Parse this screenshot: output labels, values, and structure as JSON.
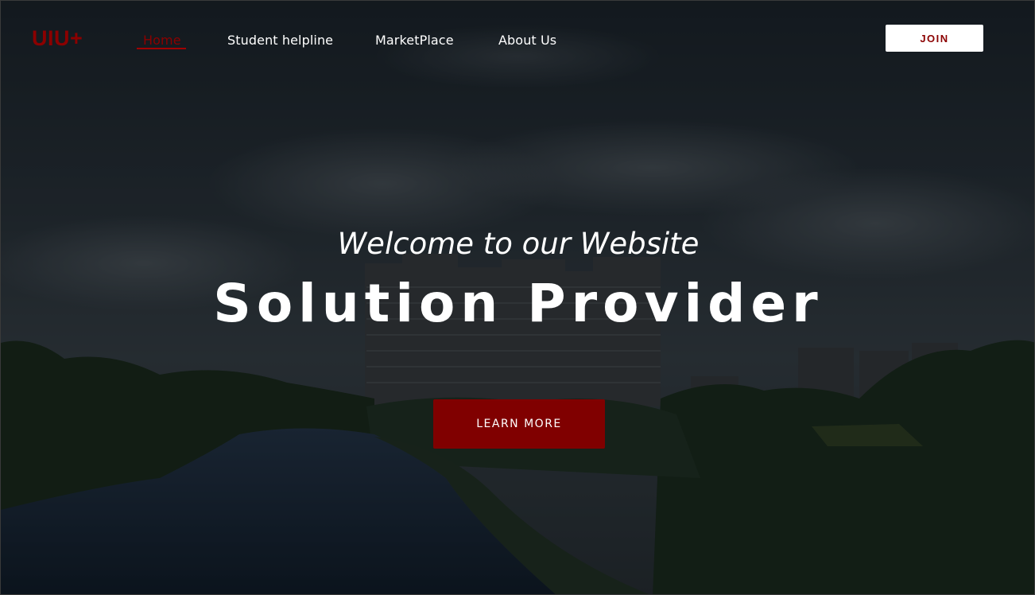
{
  "brand": {
    "logo_text": "UIU+",
    "accent_color": "#8b0000"
  },
  "nav": {
    "links": [
      {
        "label": "Home",
        "active": true
      },
      {
        "label": "Student helpline",
        "active": false
      },
      {
        "label": "MarketPlace",
        "active": false
      },
      {
        "label": "About Us",
        "active": false
      }
    ],
    "join_label": "JOIN"
  },
  "hero": {
    "welcome": "Welcome to our Website",
    "headline": "Solution Provider",
    "cta_label": "LEARN MORE",
    "cta_color": "#800000",
    "background": "photo of campus buildings beside a river under a cloudy sky"
  }
}
